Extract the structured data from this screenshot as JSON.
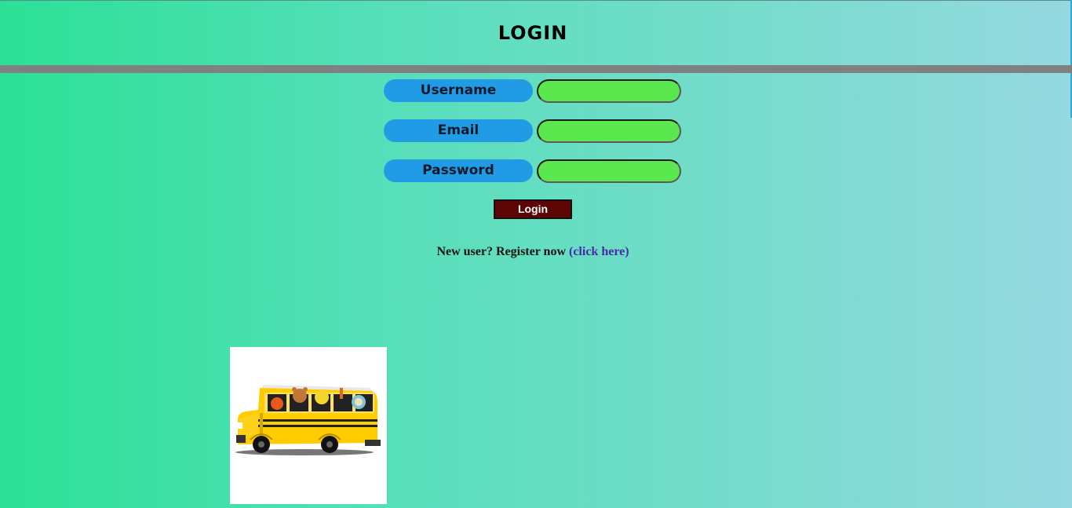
{
  "header": {
    "title": "Login"
  },
  "form": {
    "username_label": "Username",
    "email_label": "Email",
    "password_label": "Password",
    "username_value": "",
    "email_value": "",
    "password_value": "",
    "submit_label": "Login"
  },
  "register": {
    "prompt": "New user? Register now",
    "link_text": "(click here)"
  },
  "image": {
    "icon": "school-bus-icon"
  },
  "colors": {
    "label_bg": "#229be6",
    "field_bg": "#5be84f",
    "button_bg": "#5c0606",
    "divider": "#808080",
    "link": "#4a2aa8"
  }
}
